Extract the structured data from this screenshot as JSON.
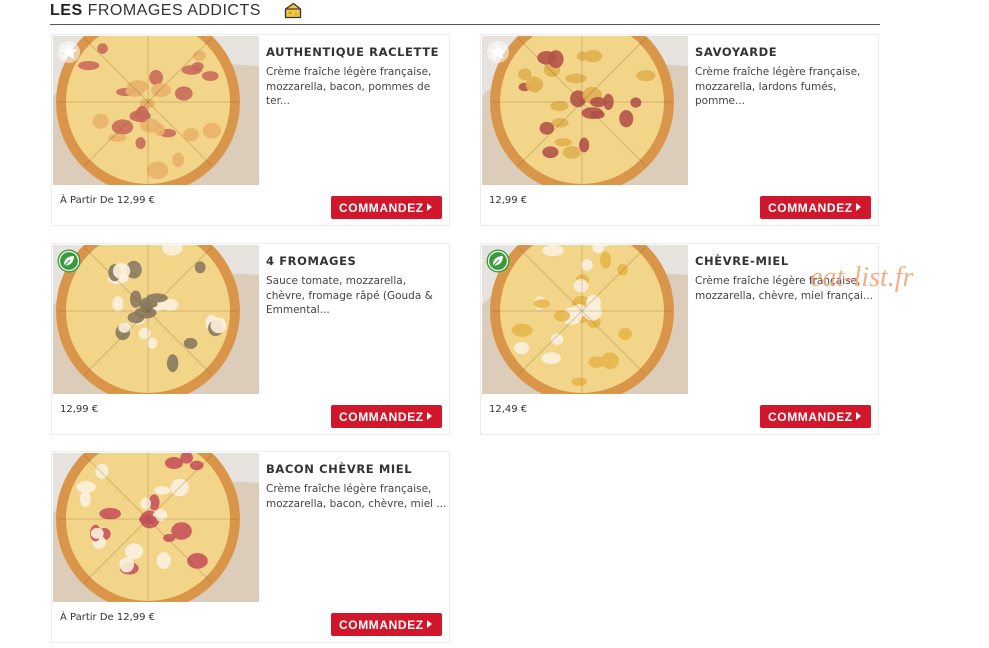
{
  "section": {
    "title_bold": "LES",
    "title_rest": "FROMAGES ADDICTS",
    "icon": "cheese-icon"
  },
  "products": [
    {
      "name": "AUTHENTIQUE RACLETTE",
      "description": "Crème fraîche légère française, mozzarella, bacon, pommes de ter...",
      "price": "À Partir De 12,99 €",
      "badge": "star-icon",
      "button_label": "COMMANDEZ"
    },
    {
      "name": "SAVOYARDE",
      "description": "Crème fraîche légère française, mozzarella, lardons fumés, pomme...",
      "price": "12,99 €",
      "badge": "star-icon",
      "button_label": "COMMANDEZ"
    },
    {
      "name": "4 FROMAGES",
      "description": "Sauce tomate, mozzarella, chèvre, fromage râpé (Gouda & Emmental...",
      "price": "12,99 €",
      "badge": "vegetarian-leaf-icon",
      "button_label": "COMMANDEZ"
    },
    {
      "name": "CHÈVRE-MIEL",
      "description": "Crème fraîche légère française, mozzarella, chèvre, miel françai...",
      "price": "12,49 €",
      "badge": "vegetarian-leaf-icon",
      "button_label": "COMMANDEZ"
    },
    {
      "name": "BACON CHÈVRE MIEL",
      "description": "Crème fraîche légère française, mozzarella, bacon, chèvre, miel ...",
      "price": "À Partir De 12,99 €",
      "badge": "",
      "button_label": "COMMANDEZ"
    }
  ],
  "watermark": "eat-list.fr",
  "colors": {
    "button": "#d0172c",
    "veg_badge": "#3a9a3c",
    "crust": "#d9954a",
    "cheese": "#f3d58a",
    "paper": "#d8c6ad",
    "watermark": "#f0a270"
  }
}
